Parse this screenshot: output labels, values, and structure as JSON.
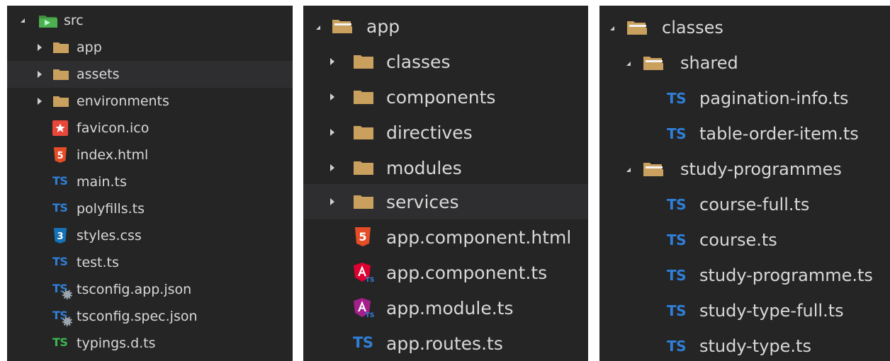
{
  "colors": {
    "panel_bg": "#252526",
    "highlight": "#2e2e30",
    "folder": "#c9a05e",
    "ts_blue": "#2f7fd8",
    "ts_green": "#3cb84e",
    "html_orange": "#e44d26",
    "css_blue": "#1572b6",
    "angular_red": "#dd0031",
    "angular_purple": "#a6120d"
  },
  "panel1": {
    "items": [
      {
        "label": "src",
        "icon": "src-folder-icon",
        "expand": "open"
      },
      {
        "label": "app",
        "icon": "folder-icon",
        "expand": "closed"
      },
      {
        "label": "assets",
        "icon": "folder-icon",
        "expand": "closed"
      },
      {
        "label": "environments",
        "icon": "folder-icon",
        "expand": "closed"
      },
      {
        "label": "favicon.ico",
        "icon": "favicon-icon"
      },
      {
        "label": "index.html",
        "icon": "html5-icon"
      },
      {
        "label": "main.ts",
        "icon": "typescript-icon",
        "badge": "TS"
      },
      {
        "label": "polyfills.ts",
        "icon": "typescript-icon",
        "badge": "TS"
      },
      {
        "label": "styles.css",
        "icon": "css3-icon"
      },
      {
        "label": "test.ts",
        "icon": "typescript-icon",
        "badge": "TS"
      },
      {
        "label": "tsconfig.app.json",
        "icon": "tsconfig-icon",
        "badge": "TS"
      },
      {
        "label": "tsconfig.spec.json",
        "icon": "tsconfig-icon",
        "badge": "TS"
      },
      {
        "label": "typings.d.ts",
        "icon": "typescript-def-icon",
        "badge": "TS"
      }
    ]
  },
  "panel2": {
    "items": [
      {
        "label": "app",
        "icon": "folder-open-icon",
        "expand": "open"
      },
      {
        "label": "classes",
        "icon": "folder-icon",
        "expand": "closed"
      },
      {
        "label": "components",
        "icon": "folder-icon",
        "expand": "closed"
      },
      {
        "label": "directives",
        "icon": "folder-icon",
        "expand": "closed"
      },
      {
        "label": "modules",
        "icon": "folder-icon",
        "expand": "closed"
      },
      {
        "label": "services",
        "icon": "folder-icon",
        "expand": "closed"
      },
      {
        "label": "app.component.html",
        "icon": "html5-icon"
      },
      {
        "label": "app.component.ts",
        "icon": "angular-icon"
      },
      {
        "label": "app.module.ts",
        "icon": "angular-module-icon"
      },
      {
        "label": "app.routes.ts",
        "icon": "typescript-icon",
        "badge": "TS"
      }
    ]
  },
  "panel3": {
    "items": [
      {
        "label": "classes",
        "icon": "folder-open-icon",
        "expand": "open"
      },
      {
        "label": "shared",
        "icon": "folder-open-icon",
        "expand": "open"
      },
      {
        "label": "pagination-info.ts",
        "icon": "typescript-icon",
        "badge": "TS"
      },
      {
        "label": "table-order-item.ts",
        "icon": "typescript-icon",
        "badge": "TS"
      },
      {
        "label": "study-programmes",
        "icon": "folder-open-icon",
        "expand": "open"
      },
      {
        "label": "course-full.ts",
        "icon": "typescript-icon",
        "badge": "TS"
      },
      {
        "label": "course.ts",
        "icon": "typescript-icon",
        "badge": "TS"
      },
      {
        "label": "study-programme.ts",
        "icon": "typescript-icon",
        "badge": "TS"
      },
      {
        "label": "study-type-full.ts",
        "icon": "typescript-icon",
        "badge": "TS"
      },
      {
        "label": "study-type.ts",
        "icon": "typescript-icon",
        "badge": "TS"
      }
    ]
  }
}
